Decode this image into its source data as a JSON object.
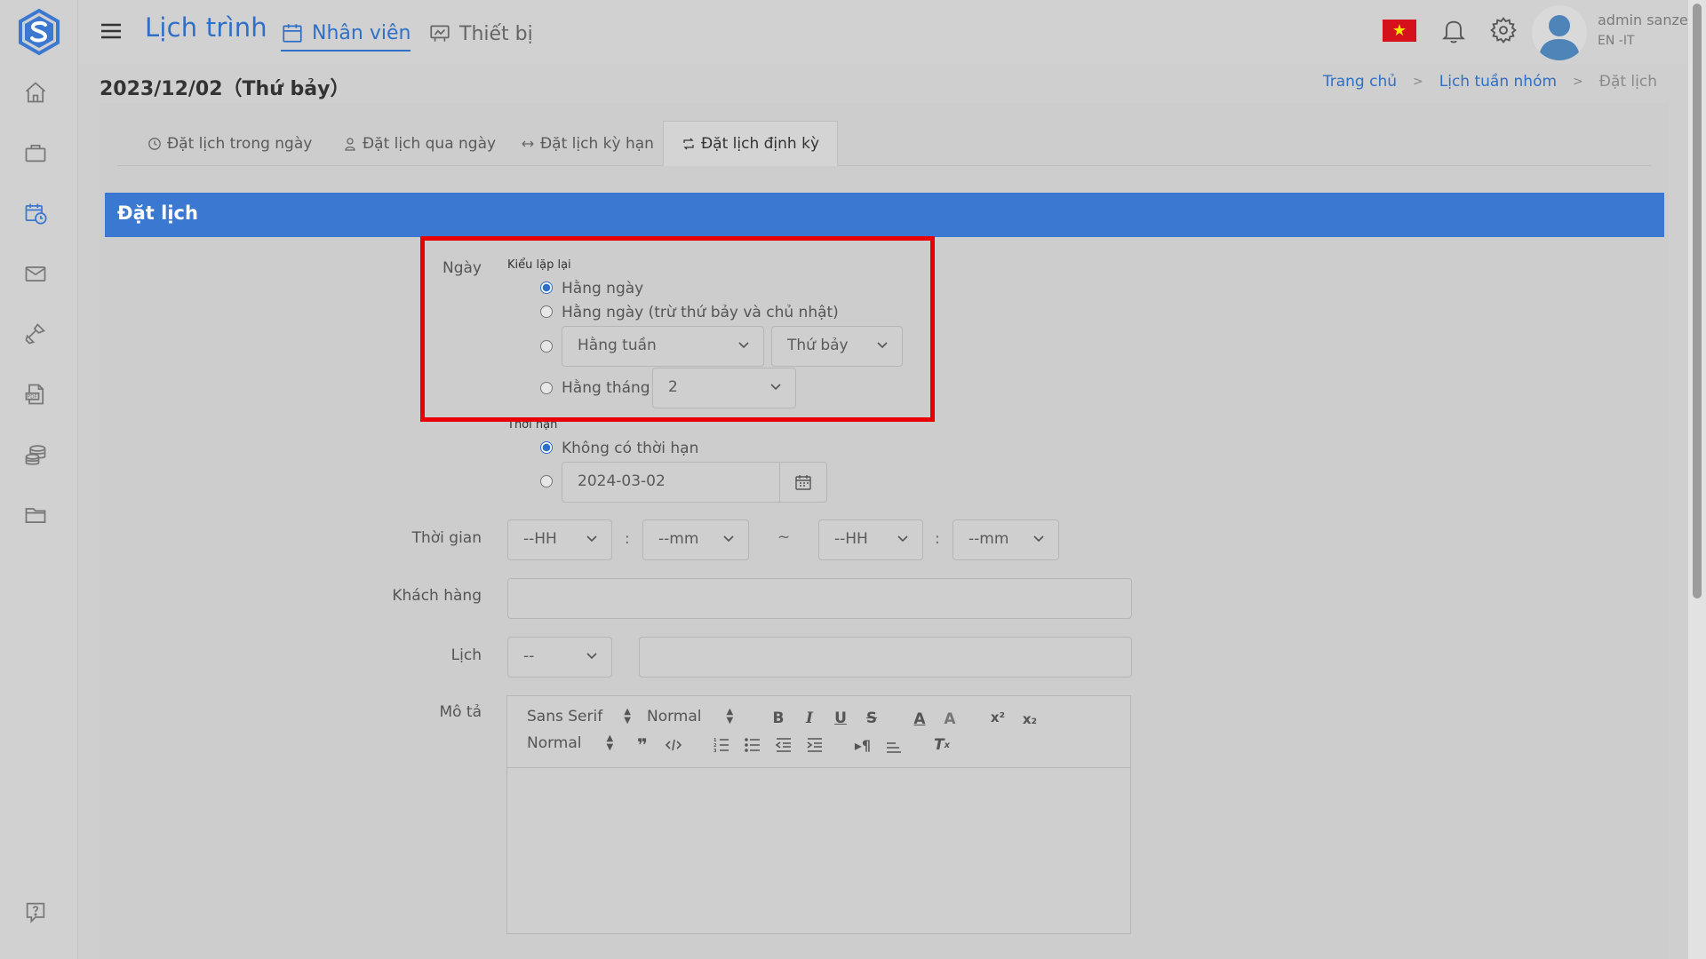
{
  "header": {
    "app_title": "Lịch trình",
    "nav": [
      {
        "label": "Nhân viên",
        "icon": "calendar-icon",
        "active": true
      },
      {
        "label": "Thiết bị",
        "icon": "device-icon",
        "active": false
      }
    ],
    "user_name": "admin sanze",
    "user_role": "EN -IT",
    "flag_icon": "vietnam-flag-icon"
  },
  "page": {
    "date_title": "2023/12/02（Thứ bảy）",
    "breadcrumbs": [
      "Trang chủ",
      "Lịch tuần nhóm",
      "Đặt lịch"
    ]
  },
  "tabs": [
    {
      "label": "Đặt lịch trong ngày",
      "icon": "clock-icon"
    },
    {
      "label": "Đặt lịch qua ngày",
      "icon": "user-icon"
    },
    {
      "label": "Đặt lịch kỳ hạn",
      "icon": "arrows-icon"
    },
    {
      "label": "Đặt lịch định kỳ",
      "icon": "repeat-icon",
      "active": true
    }
  ],
  "form": {
    "header": "Đặt lịch",
    "day_label": "Ngày",
    "repeat_type_label": "Kiểu lặp lại",
    "repeat_options": {
      "daily": "Hằng ngày",
      "weekdays": "Hằng ngày (trừ thứ bảy và chủ nhật)",
      "weekly_value": "Hằng tuần",
      "weekday_value": "Thứ bảy",
      "monthly": "Hằng tháng",
      "monthly_value": "2"
    },
    "selected_repeat": "daily",
    "deadline_label": "Thời hạn",
    "deadline_options": {
      "none": "Không có thời hạn",
      "date_value": "2024-03-02"
    },
    "time_label": "Thời gian",
    "time_start_hour": "--HH",
    "time_start_min": "--mm",
    "time_sep": "~",
    "time_colon": ":",
    "time_end_hour": "--HH",
    "time_end_min": "--mm",
    "customer_label": "Khách hàng",
    "calendar_label": "Lịch",
    "calendar_value": "--",
    "description_label": "Mô tả",
    "editor": {
      "font": "Sans Serif",
      "size": "Normal",
      "heading": "Normal"
    }
  },
  "colors": {
    "primary": "#2f6fc7",
    "form_header": "#3b78d1",
    "highlight": "#e80000"
  }
}
